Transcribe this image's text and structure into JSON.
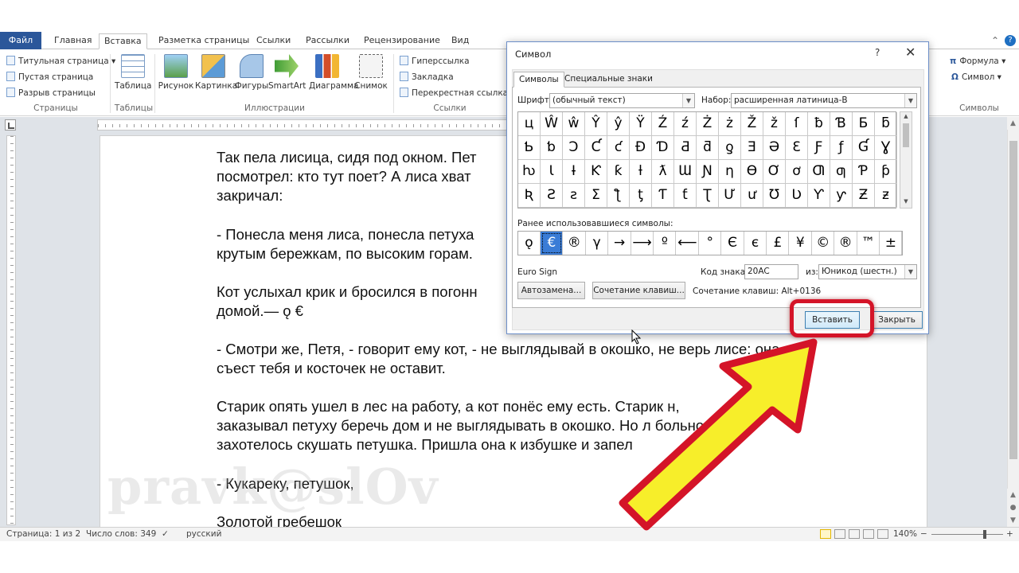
{
  "ribbon_tabs": [
    "Файл",
    "Главная",
    "Вставка",
    "Разметка страницы",
    "Ссылки",
    "Рассылки",
    "Рецензирование",
    "Вид"
  ],
  "ribbon": {
    "pages_group": {
      "items": [
        "Титульная страница",
        "Пустая страница",
        "Разрыв страницы"
      ],
      "label": "Страницы"
    },
    "tables_group": {
      "button": "Таблица",
      "label": "Таблицы"
    },
    "illustrations_group": {
      "buttons": [
        "Рисунок",
        "Картинка",
        "Фигуры",
        "SmartArt",
        "Диаграмма",
        "Снимок"
      ],
      "label": "Иллюстрации"
    },
    "links_group": {
      "items": [
        "Гиперссылка",
        "Закладка",
        "Перекрестная ссылка"
      ],
      "label": "Ссылки"
    },
    "symbols_group": {
      "items": [
        "Формула",
        "Символ"
      ],
      "label": "Символы"
    }
  },
  "document": {
    "paragraphs": [
      "Так пела лисица, сидя под окном. Пет\nпосмотрел: кто тут поет? А лиса хват\nзакричал:",
      "- Понесла меня лиса, понесла петуха\nкрутым бережкам, по высоким горам.",
      "Кот услыхал крик и бросился в погонн\nдомой.— ǫ €",
      "- Смотри же, Петя, - говорит ему кот, - не выглядывай в окошко, не верь лисе: она\nсъест тебя и косточек не оставит.",
      "Старик опять ушел в лес на работу, а кот понёс ему есть. Старик        н,\nзаказывал петуху беречь дом и не выглядывать в окошко. Но л      больно\nзахотелось скушать петушка. Пришла она к избушке и запел",
      "- Кукареку, петушок,",
      "Золотой гребешок"
    ]
  },
  "watermark": "pravk@slOv",
  "statusbar": {
    "page": "Страница: 1 из 2",
    "words": "Число слов: 349",
    "language": "русский",
    "zoom": "140%"
  },
  "dialog": {
    "title": "Символ",
    "help": "?",
    "close": "✕",
    "tabs": [
      "Символы",
      "Специальные знаки"
    ],
    "font_label": "Шрифт:",
    "font_value": "(обычный текст)",
    "subset_label": "Набор:",
    "subset_value": "расширенная латиница-B",
    "grid": [
      [
        "ц",
        "Ŵ",
        "ŵ",
        "Ŷ",
        "ŷ",
        "Ÿ",
        "Ź",
        "ź",
        "Ż",
        "ż",
        "Ž",
        "ž",
        "ſ",
        "ƀ",
        "Ɓ",
        "Ƃ",
        "ƃ"
      ],
      [
        "Ƅ",
        "ƅ",
        "Ɔ",
        "Ƈ",
        "ƈ",
        "Ɖ",
        "Ɗ",
        "Ƌ",
        "ƌ",
        "ƍ",
        "Ǝ",
        "Ə",
        "Ɛ",
        "Ƒ",
        "ƒ",
        "Ɠ",
        "Ɣ"
      ],
      [
        "ƕ",
        "Ɩ",
        "Ɨ",
        "Ƙ",
        "ƙ",
        "ƚ",
        "ƛ",
        "Ɯ",
        "Ɲ",
        "ƞ",
        "Ɵ",
        "Ơ",
        "ơ",
        "Ƣ",
        "ƣ",
        "Ƥ",
        "ƥ"
      ],
      [
        "Ʀ",
        "Ƨ",
        "ƨ",
        "Ʃ",
        "ƪ",
        "ƫ",
        "Ƭ",
        "ƭ",
        "Ʈ",
        "Ư",
        "ư",
        "Ʊ",
        "Ʋ",
        "Ƴ",
        "ƴ",
        "Ƶ",
        "ƶ"
      ]
    ],
    "recent_label": "Ранее использовавшиеся символы:",
    "recent": [
      "ǫ",
      "€",
      "®",
      "γ",
      "→",
      "⟶",
      "º",
      "⟵",
      "°",
      "Є",
      "є",
      "£",
      "¥",
      "©",
      "®",
      "™",
      "±"
    ],
    "selected_recent_index": 1,
    "char_name": "Euro Sign",
    "code_label": "Код знака:",
    "code_value": "20AC",
    "from_label": "из:",
    "from_value": "Юникод (шестн.)",
    "autocorrect_button": "Автозамена...",
    "shortcut_button": "Сочетание клавиш...",
    "shortcut_text": "Сочетание клавиш: Alt+0136",
    "insert_button": "Вставить",
    "close_button": "Закрыть"
  },
  "colors": {
    "file_tab": "#2b579a",
    "highlight_ring": "#d41428",
    "arrow_fill": "#f7ee2a",
    "arrow_stroke": "#d41428",
    "selected_cell": "#3a7cd6"
  }
}
